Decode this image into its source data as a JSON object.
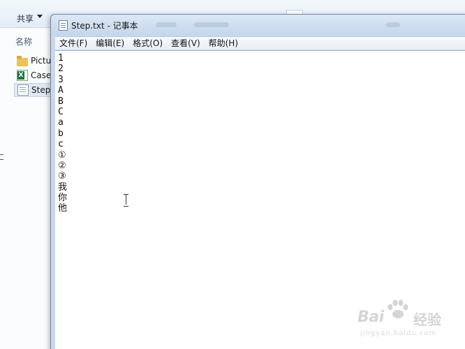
{
  "explorer": {
    "toolbar": {
      "share_label": "共享"
    },
    "column_header": "名称",
    "files": [
      {
        "name": "Pictu",
        "icon": "folder-icon"
      },
      {
        "name": "Case",
        "icon": "excel-icon"
      },
      {
        "name": "Step.",
        "icon": "text-file-icon"
      }
    ]
  },
  "notepad": {
    "title": "Step.txt - 记事本",
    "menu": [
      "文件(F)",
      "编辑(E)",
      "格式(O)",
      "查看(V)",
      "帮助(H)"
    ],
    "content_lines": [
      "1",
      "2",
      "3",
      "A",
      "B",
      "C",
      "a",
      "b",
      "c",
      "①",
      "②",
      "③",
      "我",
      "你",
      "他"
    ]
  },
  "watermark": {
    "brand": "Bai",
    "brand_tail": "经验",
    "sub": "jingyan.baidu.com"
  }
}
